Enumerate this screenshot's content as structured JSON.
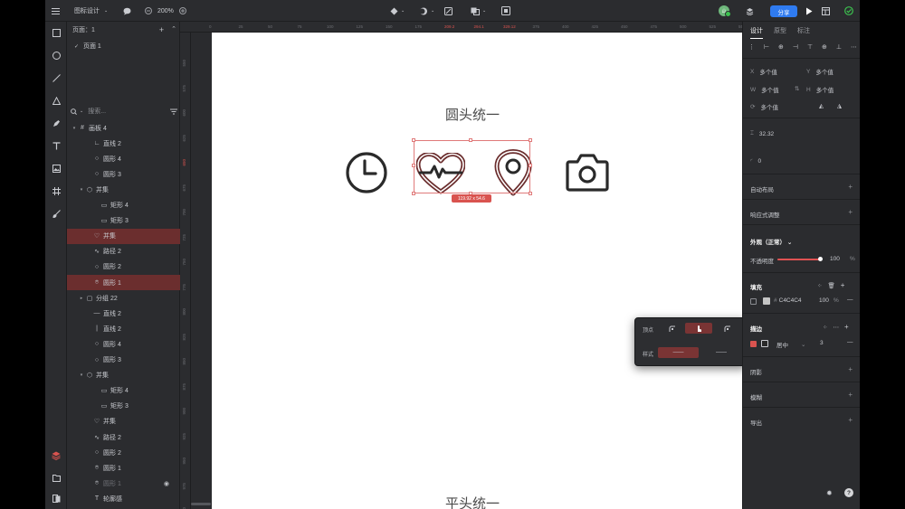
{
  "topbar": {
    "file_name": "图标设计",
    "zoom": "200%",
    "share_label": "分享",
    "avatar_text": "山"
  },
  "pages": {
    "header": "页面：1",
    "items": [
      "页面 1"
    ]
  },
  "layers": {
    "search_placeholder": "搜索...",
    "items": [
      {
        "label": "画板 4",
        "icon": "#",
        "arrow": "▾",
        "indent": 4
      },
      {
        "label": "直线 2",
        "icon": "∟",
        "arrow": "",
        "indent": 20
      },
      {
        "label": "圆形 4",
        "icon": "○",
        "arrow": "",
        "indent": 20
      },
      {
        "label": "圆形 3",
        "icon": "○",
        "arrow": "",
        "indent": 20
      },
      {
        "label": "并集",
        "icon": "⬡",
        "arrow": "▾",
        "indent": 12
      },
      {
        "label": "矩形 4",
        "icon": "▭",
        "arrow": "",
        "indent": 28
      },
      {
        "label": "矩形 3",
        "icon": "▭",
        "arrow": "",
        "indent": 28
      },
      {
        "label": "并集",
        "icon": "♡",
        "arrow": "",
        "indent": 20,
        "selected": true
      },
      {
        "label": "路径 2",
        "icon": "∿",
        "arrow": "",
        "indent": 20
      },
      {
        "label": "圆形 2",
        "icon": "○",
        "arrow": "",
        "indent": 20
      },
      {
        "label": "圆形 1",
        "icon": "⌾",
        "arrow": "",
        "indent": 20,
        "selected": true
      },
      {
        "label": "分组 22",
        "icon": "▢",
        "arrow": "▸",
        "indent": 12
      },
      {
        "label": "直线 2",
        "icon": "—",
        "arrow": "",
        "indent": 20
      },
      {
        "label": "直线 2",
        "icon": "|",
        "arrow": "",
        "indent": 20
      },
      {
        "label": "圆形 4",
        "icon": "○",
        "arrow": "",
        "indent": 20
      },
      {
        "label": "圆形 3",
        "icon": "○",
        "arrow": "",
        "indent": 20
      },
      {
        "label": "并集",
        "icon": "⬡",
        "arrow": "▾",
        "indent": 12
      },
      {
        "label": "矩形 4",
        "icon": "▭",
        "arrow": "",
        "indent": 28
      },
      {
        "label": "矩形 3",
        "icon": "▭",
        "arrow": "",
        "indent": 28
      },
      {
        "label": "并集",
        "icon": "♡",
        "arrow": "",
        "indent": 20
      },
      {
        "label": "路径 2",
        "icon": "∿",
        "arrow": "",
        "indent": 20
      },
      {
        "label": "圆形 2",
        "icon": "○",
        "arrow": "",
        "indent": 20
      },
      {
        "label": "圆形 1",
        "icon": "⌾",
        "arrow": "",
        "indent": 20
      },
      {
        "label": "圆形 1",
        "icon": "⌾",
        "arrow": "",
        "indent": 20,
        "dim": true,
        "eye": true
      },
      {
        "label": "轮廓感",
        "icon": "T",
        "arrow": "",
        "indent": 20
      }
    ]
  },
  "ruler": {
    "top": [
      "0",
      "25",
      "50",
      "75",
      "100",
      "125",
      "150",
      "175",
      "209.2",
      "294.1",
      "329.12",
      "375",
      "400",
      "425",
      "450",
      "475",
      "500",
      "525",
      "55"
    ],
    "top_highlight": [
      "209.2",
      "294.1",
      "329.12"
    ],
    "left": [
      "550",
      "575",
      "600",
      "625",
      "650",
      "675",
      "700",
      "725",
      "750",
      "775",
      "800",
      "825",
      "850",
      "875",
      "900",
      "925",
      "950",
      "975",
      "1000"
    ],
    "left_highlight": [
      "650"
    ]
  },
  "canvas": {
    "title_top": "圆头统一",
    "title_bottom": "平头统一",
    "size_badge": "119.92 x 54.6",
    "icons": [
      "clock-icon",
      "heart-pulse-icon",
      "location-pin-icon",
      "camera-icon"
    ],
    "icon_color": "#2a2a2a",
    "selected_color": "#6b2e2e"
  },
  "popover": {
    "vertex_label": "顶点",
    "style_label": "样式",
    "vertex_options": [
      "round-corner-left",
      "round-corner-mid",
      "round-corner-right"
    ],
    "style_options": [
      "——",
      "——"
    ]
  },
  "rpanel": {
    "tabs": [
      "设计",
      "原型",
      "标注"
    ],
    "x_label": "X",
    "x_value": "多个值",
    "y_label": "Y",
    "y_value": "多个值",
    "w_label": "W",
    "w_value": "多个值",
    "h_label": "H",
    "h_value": "多个值",
    "rotate_value": "多个值",
    "height_value": "32.32",
    "radius_value": "0",
    "auto_layout": "自动布局",
    "responsive": "响应式调整",
    "appearance": "外观（正常）",
    "opacity_label": "不透明度",
    "opacity_value": "100",
    "opacity_unit": "%",
    "opacity_level": 1.0,
    "fill_title": "填充",
    "fill_hex": "C4C4C4",
    "fill_opacity": "100",
    "fill_unit": "%",
    "fill_color": "#C4C4C4",
    "stroke_title": "描边",
    "stroke_position": "居中",
    "stroke_width": "3",
    "shadow": "阴影",
    "blur": "模糊",
    "export": "导出",
    "accent": "#d9534f"
  }
}
